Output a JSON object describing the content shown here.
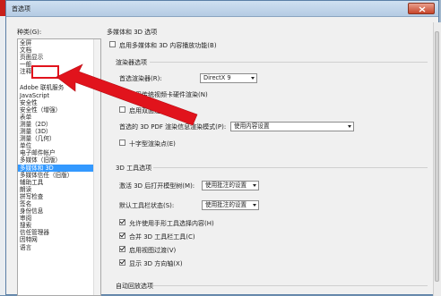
{
  "window": {
    "title": "首选项"
  },
  "categories": {
    "label": "种类(G):",
    "top": [
      "全屏",
      "文档",
      "页面显示",
      "一般",
      "注释"
    ],
    "items": [
      "Adobe 联机服务",
      "JavaScript",
      "安全性",
      "安全性（增强）",
      "表单",
      "测量（2D）",
      "测量（3D）",
      "测量（几何）",
      "单位",
      "电子邮件帐户",
      "多媒体（旧版）",
      "多媒体和 3D",
      "多媒体信任（旧版）",
      "辅助工具",
      "朗读",
      "拼写检查",
      "签名",
      "身份信息",
      "审阅",
      "搜索",
      "信任管理器",
      "因特网",
      "语言"
    ],
    "selected": "多媒体和 3D",
    "highlighted": "一般"
  },
  "panel": {
    "section_title": "多媒体和 3D 选项",
    "enable_3d": "启用多媒体和 3D 内容播放功能(B)",
    "renderer_group": "渲染器选项",
    "preferred_renderer_label": "首选渲染器(R):",
    "preferred_renderer_value": "DirectX 9",
    "hw_render": "启用传统视频卡硬件渲染(N)",
    "double_sided": "启用双面渲染(D)",
    "pref_mode_label": "首选的 3D PDF 渲染信息渲染模式(P):",
    "pref_mode_value": "使用内容设置",
    "crosshair": "十字型渲染点(E)",
    "tools_group": "3D 工具选项",
    "open_tree_label": "激活 3D 后打开模型树(M):",
    "open_tree_value": "使用批注的设置",
    "default_toolbar_label": "默认工具栏状态(S):",
    "default_toolbar_value": "使用批注的设置",
    "allow_select": "允许使用手形工具选择内容(H)",
    "merge_toolbar": "合并 3D 工具栏工具(C)",
    "view_transition": "启用视图过渡(V)",
    "show_axes": "显示 3D 方向轴(X)",
    "playback_group": "自动回放选项"
  },
  "states": {
    "enable_3d": false,
    "hw_render": true,
    "double_sided": false,
    "crosshair": false,
    "allow_select": true,
    "merge_toolbar": true,
    "view_transition": true,
    "show_axes": true
  },
  "colors": {
    "selection": "#3399ff",
    "highlight": "#e1131c",
    "title_bar": "#c5d7ea"
  }
}
